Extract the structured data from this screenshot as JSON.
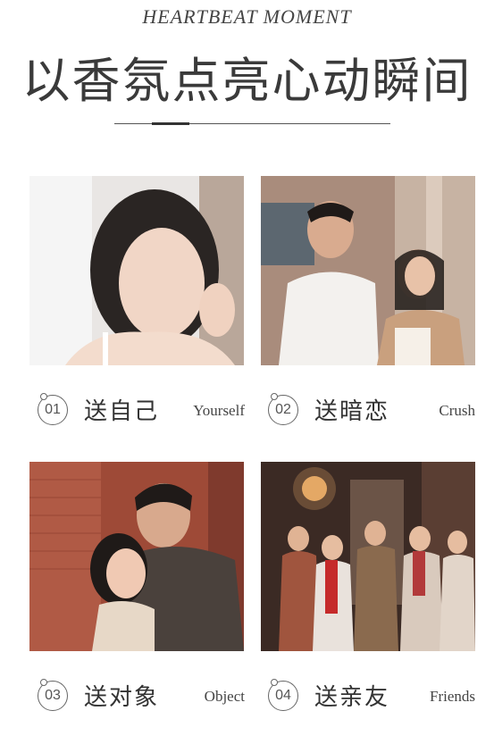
{
  "header": {
    "subtitle": "HEARTBEAT MOMENT",
    "title": "以香氛点亮心动瞬间"
  },
  "cards": [
    {
      "num": "01",
      "label_cn": "送自己",
      "label_en": "Yourself",
      "photo": "portrait of smiling woman"
    },
    {
      "num": "02",
      "label_cn": "送暗恋",
      "label_en": "Crush",
      "photo": "man and woman walking"
    },
    {
      "num": "03",
      "label_cn": "送对象",
      "label_en": "Object",
      "photo": "couple embracing"
    },
    {
      "num": "04",
      "label_cn": "送亲友",
      "label_en": "Friends",
      "photo": "group of friends celebrating"
    }
  ],
  "colors": {
    "text": "#333333",
    "line": "#555555"
  }
}
